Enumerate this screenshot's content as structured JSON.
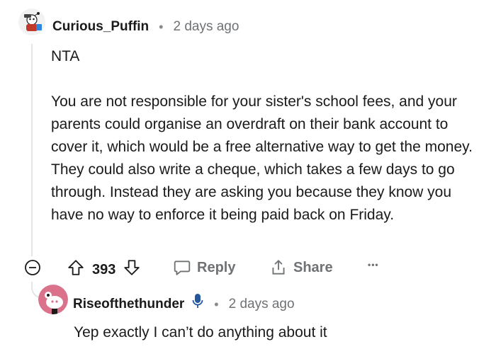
{
  "comment": {
    "username": "Curious_Puffin",
    "separator": "•",
    "time": "2 days ago",
    "paragraphs": [
      "NTA",
      "You are not responsible for your sister's school fees, and your parents could organise an overdraft on their bank account to cover it, which would be a free alternative way to get the money. They could also write a cheque, which takes a few days to go through. Instead they are asking you because they know you have no way to enforce it being paid back on Friday."
    ],
    "score": "393",
    "reply_label": "Reply",
    "share_label": "Share",
    "more_label": "•••"
  },
  "reply": {
    "username": "Riseofthethunder",
    "separator": "•",
    "time": "2 days ago",
    "text": "Yep exactly I can’t do anything about it"
  },
  "icons": {
    "collapse": "minus-circle-icon",
    "upvote": "arrow-up-icon",
    "downvote": "arrow-down-icon",
    "reply": "speech-bubble-icon",
    "share": "share-icon",
    "more": "ellipsis-icon",
    "mic": "microphone-icon"
  },
  "colors": {
    "text": "#1a1a1b",
    "muted": "#6f7275",
    "thread_line": "#e5e5e5",
    "mic_blue": "#24579c",
    "reply_avatar_bg": "#d9728a"
  }
}
